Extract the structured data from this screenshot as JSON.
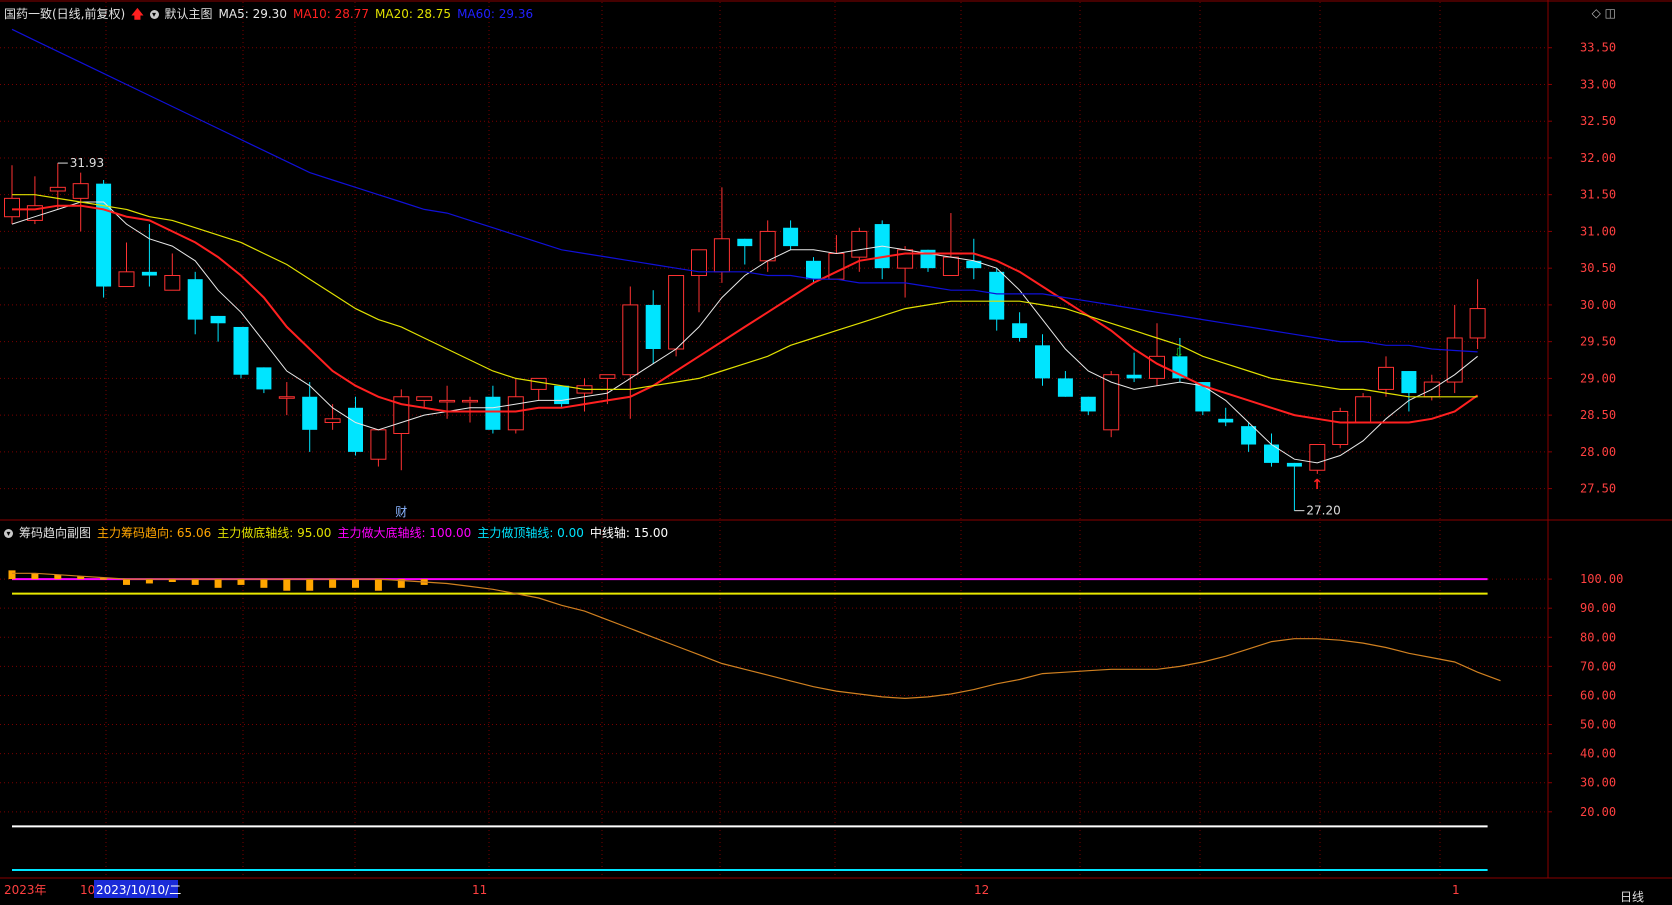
{
  "header": {
    "title": "国药一致(日线,前复权)",
    "main_chart_label": "默认主图",
    "ma5_label": "MA5: 29.30",
    "ma10_label": "MA10: 28.77",
    "ma20_label": "MA20: 28.75",
    "ma60_label": "MA60: 29.36"
  },
  "sub_header": {
    "title": "筹码趋向副图",
    "l1": "主力筹码趋向: 65.06",
    "l2": "主力做底轴线: 95.00",
    "l3": "主力做大底轴线: 100.00",
    "l4": "主力做顶轴线: 0.00",
    "l5": "中线轴: 15.00"
  },
  "colors": {
    "up": "#ff3232",
    "down": "#00e5ff",
    "ma5": "#e8e8e8",
    "ma10": "#ff2020",
    "ma20": "#e0e000",
    "ma60": "#1010d8",
    "grid": "#7a0000",
    "axis_text": "#ff4040",
    "bar": "#ffa500",
    "line_main": "#d08020",
    "line_100": "#ff00ff",
    "line_95": "#e8e800",
    "line_15": "#ffffff",
    "line_0": "#00e5ff"
  },
  "chart_data": [
    {
      "type": "candlestick",
      "y_ticks": [
        "33.50",
        "33.00",
        "32.50",
        "32.00",
        "31.50",
        "31.00",
        "30.50",
        "30.00",
        "29.50",
        "29.00",
        "28.50",
        "28.00",
        "27.50"
      ],
      "ylim": [
        27.1,
        33.85
      ],
      "x_axis_labels": [
        "2023年",
        "10",
        "2023/10/10/二",
        "11",
        "12",
        "1"
      ],
      "period_label": "日线",
      "annotations": {
        "high": "31.93",
        "low": "27.20",
        "finance_marker": "财"
      },
      "ohlc": [
        [
          31.2,
          31.45,
          31.1,
          31.9
        ],
        [
          31.15,
          31.35,
          31.1,
          31.75
        ],
        [
          31.55,
          31.6,
          31.3,
          31.93
        ],
        [
          31.45,
          31.65,
          31.0,
          31.8
        ],
        [
          31.65,
          30.25,
          30.1,
          31.7
        ],
        [
          30.25,
          30.45,
          30.25,
          30.85
        ],
        [
          30.45,
          30.4,
          30.25,
          31.1
        ],
        [
          30.2,
          30.4,
          30.2,
          30.7
        ],
        [
          30.35,
          29.8,
          29.6,
          30.45
        ],
        [
          29.85,
          29.75,
          29.5,
          29.85
        ],
        [
          29.7,
          29.05,
          29.0,
          29.7
        ],
        [
          29.15,
          28.85,
          28.8,
          29.15
        ],
        [
          28.75,
          28.75,
          28.5,
          28.95
        ],
        [
          28.75,
          28.3,
          28.0,
          28.95
        ],
        [
          28.4,
          28.45,
          28.3,
          28.65
        ],
        [
          28.6,
          28.0,
          27.95,
          28.75
        ],
        [
          27.9,
          28.3,
          27.8,
          28.3
        ],
        [
          28.25,
          28.75,
          27.75,
          28.85
        ],
        [
          28.7,
          28.75,
          28.6,
          28.75
        ],
        [
          28.7,
          28.7,
          28.45,
          28.9
        ],
        [
          28.7,
          28.7,
          28.4,
          28.75
        ],
        [
          28.75,
          28.3,
          28.25,
          28.9
        ],
        [
          28.3,
          28.75,
          28.25,
          29.0
        ],
        [
          28.85,
          29.0,
          28.7,
          29.0
        ],
        [
          28.9,
          28.65,
          28.6,
          28.9
        ],
        [
          28.8,
          28.9,
          28.55,
          29.0
        ],
        [
          29.0,
          29.05,
          28.65,
          29.05
        ],
        [
          29.05,
          30.0,
          28.45,
          30.25
        ],
        [
          30.0,
          29.4,
          29.2,
          30.2
        ],
        [
          29.4,
          30.4,
          29.3,
          30.4
        ],
        [
          30.4,
          30.75,
          29.9,
          30.75
        ],
        [
          30.45,
          30.9,
          30.3,
          31.6
        ],
        [
          30.9,
          30.8,
          30.55,
          30.9
        ],
        [
          30.6,
          31.0,
          30.45,
          31.15
        ],
        [
          31.05,
          30.8,
          30.75,
          31.15
        ],
        [
          30.6,
          30.35,
          30.3,
          30.65
        ],
        [
          30.35,
          30.7,
          30.35,
          30.95
        ],
        [
          30.65,
          31.0,
          30.45,
          31.05
        ],
        [
          31.1,
          30.5,
          30.35,
          31.15
        ],
        [
          30.5,
          30.75,
          30.1,
          30.8
        ],
        [
          30.75,
          30.5,
          30.45,
          30.75
        ],
        [
          30.4,
          30.65,
          30.4,
          31.25
        ],
        [
          30.6,
          30.5,
          30.35,
          30.9
        ],
        [
          30.45,
          29.8,
          29.65,
          30.5
        ],
        [
          29.75,
          29.55,
          29.5,
          29.9
        ],
        [
          29.45,
          29.0,
          28.9,
          29.6
        ],
        [
          29.0,
          28.75,
          28.75,
          29.1
        ],
        [
          28.75,
          28.55,
          28.5,
          28.75
        ],
        [
          28.3,
          29.05,
          28.2,
          29.1
        ],
        [
          29.05,
          29.0,
          28.95,
          29.35
        ],
        [
          29.0,
          29.3,
          28.9,
          29.75
        ],
        [
          29.3,
          29.0,
          28.95,
          29.55
        ],
        [
          28.95,
          28.55,
          28.5,
          28.95
        ],
        [
          28.45,
          28.4,
          28.35,
          28.6
        ],
        [
          28.35,
          28.1,
          28.0,
          28.4
        ],
        [
          28.1,
          27.85,
          27.8,
          28.25
        ],
        [
          27.85,
          27.8,
          27.2,
          27.85
        ],
        [
          27.75,
          28.1,
          27.7,
          28.1
        ],
        [
          28.1,
          28.55,
          28.05,
          28.6
        ],
        [
          28.4,
          28.75,
          28.4,
          28.8
        ],
        [
          28.85,
          29.15,
          28.75,
          29.3
        ],
        [
          29.1,
          28.8,
          28.55,
          29.1
        ],
        [
          28.75,
          28.95,
          28.7,
          29.05
        ],
        [
          28.95,
          29.55,
          28.8,
          30.0
        ],
        [
          29.55,
          29.95,
          29.4,
          30.35
        ]
      ],
      "series": [
        {
          "name": "MA5",
          "values": [
            31.1,
            31.2,
            31.3,
            31.4,
            31.4,
            31.1,
            30.9,
            30.8,
            30.6,
            30.2,
            29.9,
            29.5,
            29.1,
            28.9,
            28.6,
            28.4,
            28.3,
            28.4,
            28.5,
            28.55,
            28.6,
            28.6,
            28.65,
            28.7,
            28.7,
            28.75,
            28.8,
            29.0,
            29.2,
            29.4,
            29.7,
            30.1,
            30.4,
            30.6,
            30.75,
            30.75,
            30.7,
            30.75,
            30.8,
            30.75,
            30.7,
            30.65,
            30.6,
            30.5,
            30.2,
            29.8,
            29.4,
            29.1,
            28.95,
            28.85,
            28.9,
            28.95,
            28.9,
            28.7,
            28.4,
            28.1,
            27.9,
            27.85,
            27.95,
            28.15,
            28.45,
            28.7,
            28.85,
            29.05,
            29.3
          ]
        },
        {
          "name": "MA10",
          "values": [
            31.3,
            31.3,
            31.35,
            31.35,
            31.3,
            31.2,
            31.15,
            31.0,
            30.85,
            30.65,
            30.4,
            30.1,
            29.7,
            29.4,
            29.1,
            28.9,
            28.75,
            28.65,
            28.6,
            28.55,
            28.55,
            28.55,
            28.55,
            28.6,
            28.6,
            28.65,
            28.7,
            28.75,
            28.9,
            29.1,
            29.3,
            29.5,
            29.7,
            29.9,
            30.1,
            30.3,
            30.45,
            30.6,
            30.65,
            30.7,
            30.7,
            30.7,
            30.7,
            30.6,
            30.45,
            30.25,
            30.05,
            29.85,
            29.65,
            29.4,
            29.2,
            29.05,
            28.9,
            28.8,
            28.7,
            28.6,
            28.5,
            28.45,
            28.4,
            28.4,
            28.4,
            28.4,
            28.45,
            28.55,
            28.77
          ]
        },
        {
          "name": "MA20",
          "values": [
            31.5,
            31.5,
            31.45,
            31.4,
            31.35,
            31.3,
            31.2,
            31.15,
            31.05,
            30.95,
            30.85,
            30.7,
            30.55,
            30.35,
            30.15,
            29.95,
            29.8,
            29.7,
            29.55,
            29.4,
            29.25,
            29.1,
            29.0,
            28.95,
            28.9,
            28.85,
            28.85,
            28.85,
            28.9,
            28.95,
            29.0,
            29.1,
            29.2,
            29.3,
            29.45,
            29.55,
            29.65,
            29.75,
            29.85,
            29.95,
            30.0,
            30.05,
            30.05,
            30.05,
            30.05,
            30.0,
            29.95,
            29.85,
            29.75,
            29.65,
            29.55,
            29.45,
            29.3,
            29.2,
            29.1,
            29.0,
            28.95,
            28.9,
            28.85,
            28.85,
            28.8,
            28.75,
            28.75,
            28.75,
            28.75
          ]
        },
        {
          "name": "MA60",
          "values": [
            33.75,
            33.6,
            33.45,
            33.3,
            33.15,
            33.0,
            32.85,
            32.7,
            32.55,
            32.4,
            32.25,
            32.1,
            31.95,
            31.8,
            31.7,
            31.6,
            31.5,
            31.4,
            31.3,
            31.25,
            31.15,
            31.05,
            30.95,
            30.85,
            30.75,
            30.7,
            30.65,
            30.6,
            30.55,
            30.5,
            30.45,
            30.45,
            30.45,
            30.4,
            30.4,
            30.35,
            30.35,
            30.3,
            30.3,
            30.3,
            30.25,
            30.2,
            30.2,
            30.15,
            30.15,
            30.15,
            30.1,
            30.05,
            30.0,
            29.95,
            29.9,
            29.85,
            29.8,
            29.75,
            29.7,
            29.65,
            29.6,
            29.55,
            29.5,
            29.5,
            29.45,
            29.45,
            29.4,
            29.38,
            29.36
          ]
        }
      ]
    },
    {
      "type": "line",
      "y_ticks": [
        "100.00",
        "90.00",
        "80.00",
        "70.00",
        "60.00",
        "50.00",
        "40.00",
        "30.00",
        "20.00"
      ],
      "ylim": [
        0,
        110
      ],
      "series": [
        {
          "name": "主力筹码趋向",
          "values": [
            102,
            102,
            101.5,
            101,
            100.5,
            100,
            100,
            100,
            100,
            100,
            100,
            100,
            100,
            100,
            100,
            100,
            100,
            99.5,
            99,
            98.5,
            97.5,
            96.5,
            95,
            93.5,
            91,
            89,
            86,
            83,
            80,
            77,
            74,
            71,
            69,
            67,
            65,
            63,
            61.5,
            60.5,
            59.5,
            59,
            59.5,
            60.5,
            62,
            64,
            65.5,
            67.5,
            68,
            68.5,
            69,
            69,
            69,
            70,
            71.5,
            73.5,
            76,
            78.5,
            79.5,
            79.5,
            79,
            78,
            76.5,
            74.5,
            73,
            71.5,
            68,
            65.06
          ]
        },
        {
          "name": "主力做大底轴线",
          "values": [
            100
          ]
        },
        {
          "name": "主力做底轴线",
          "values": [
            95
          ]
        },
        {
          "name": "中线轴",
          "values": [
            15
          ]
        },
        {
          "name": "主力做顶轴线",
          "values": [
            0
          ]
        }
      ],
      "bars": [
        3,
        2,
        1.5,
        1,
        0.5,
        -2,
        -1.5,
        -1,
        -2,
        -3,
        -2,
        -3,
        -4,
        -4,
        -3,
        -3,
        -4,
        -3,
        -2
      ]
    }
  ]
}
